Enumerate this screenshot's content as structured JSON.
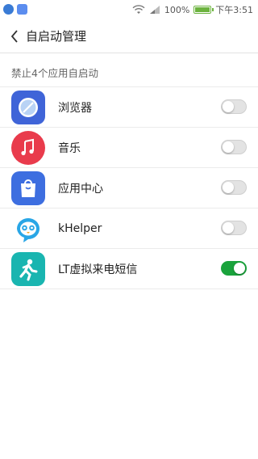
{
  "status_bar": {
    "battery": "100%",
    "battery_level": 1.0,
    "time": "下午3:51"
  },
  "header": {
    "title": "自启动管理"
  },
  "section": {
    "label": "禁止4个应用自启动"
  },
  "apps": [
    {
      "name": "浏览器",
      "icon": "browser-icon",
      "enabled": false,
      "color": "#3f64d8"
    },
    {
      "name": "音乐",
      "icon": "music-icon",
      "enabled": false,
      "color": "#e93b4c"
    },
    {
      "name": "应用中心",
      "icon": "app-center-icon",
      "enabled": false,
      "color": "#3d6ee0"
    },
    {
      "name": "kHelper",
      "icon": "khelper-icon",
      "enabled": false,
      "color": "#29a6e6"
    },
    {
      "name": "LT虚拟来电短信",
      "icon": "lt-call-icon",
      "enabled": true,
      "color": "#19b5b0"
    }
  ],
  "colors": {
    "toggle_on": "#1aa33c",
    "toggle_off": "#e3e3e3"
  }
}
